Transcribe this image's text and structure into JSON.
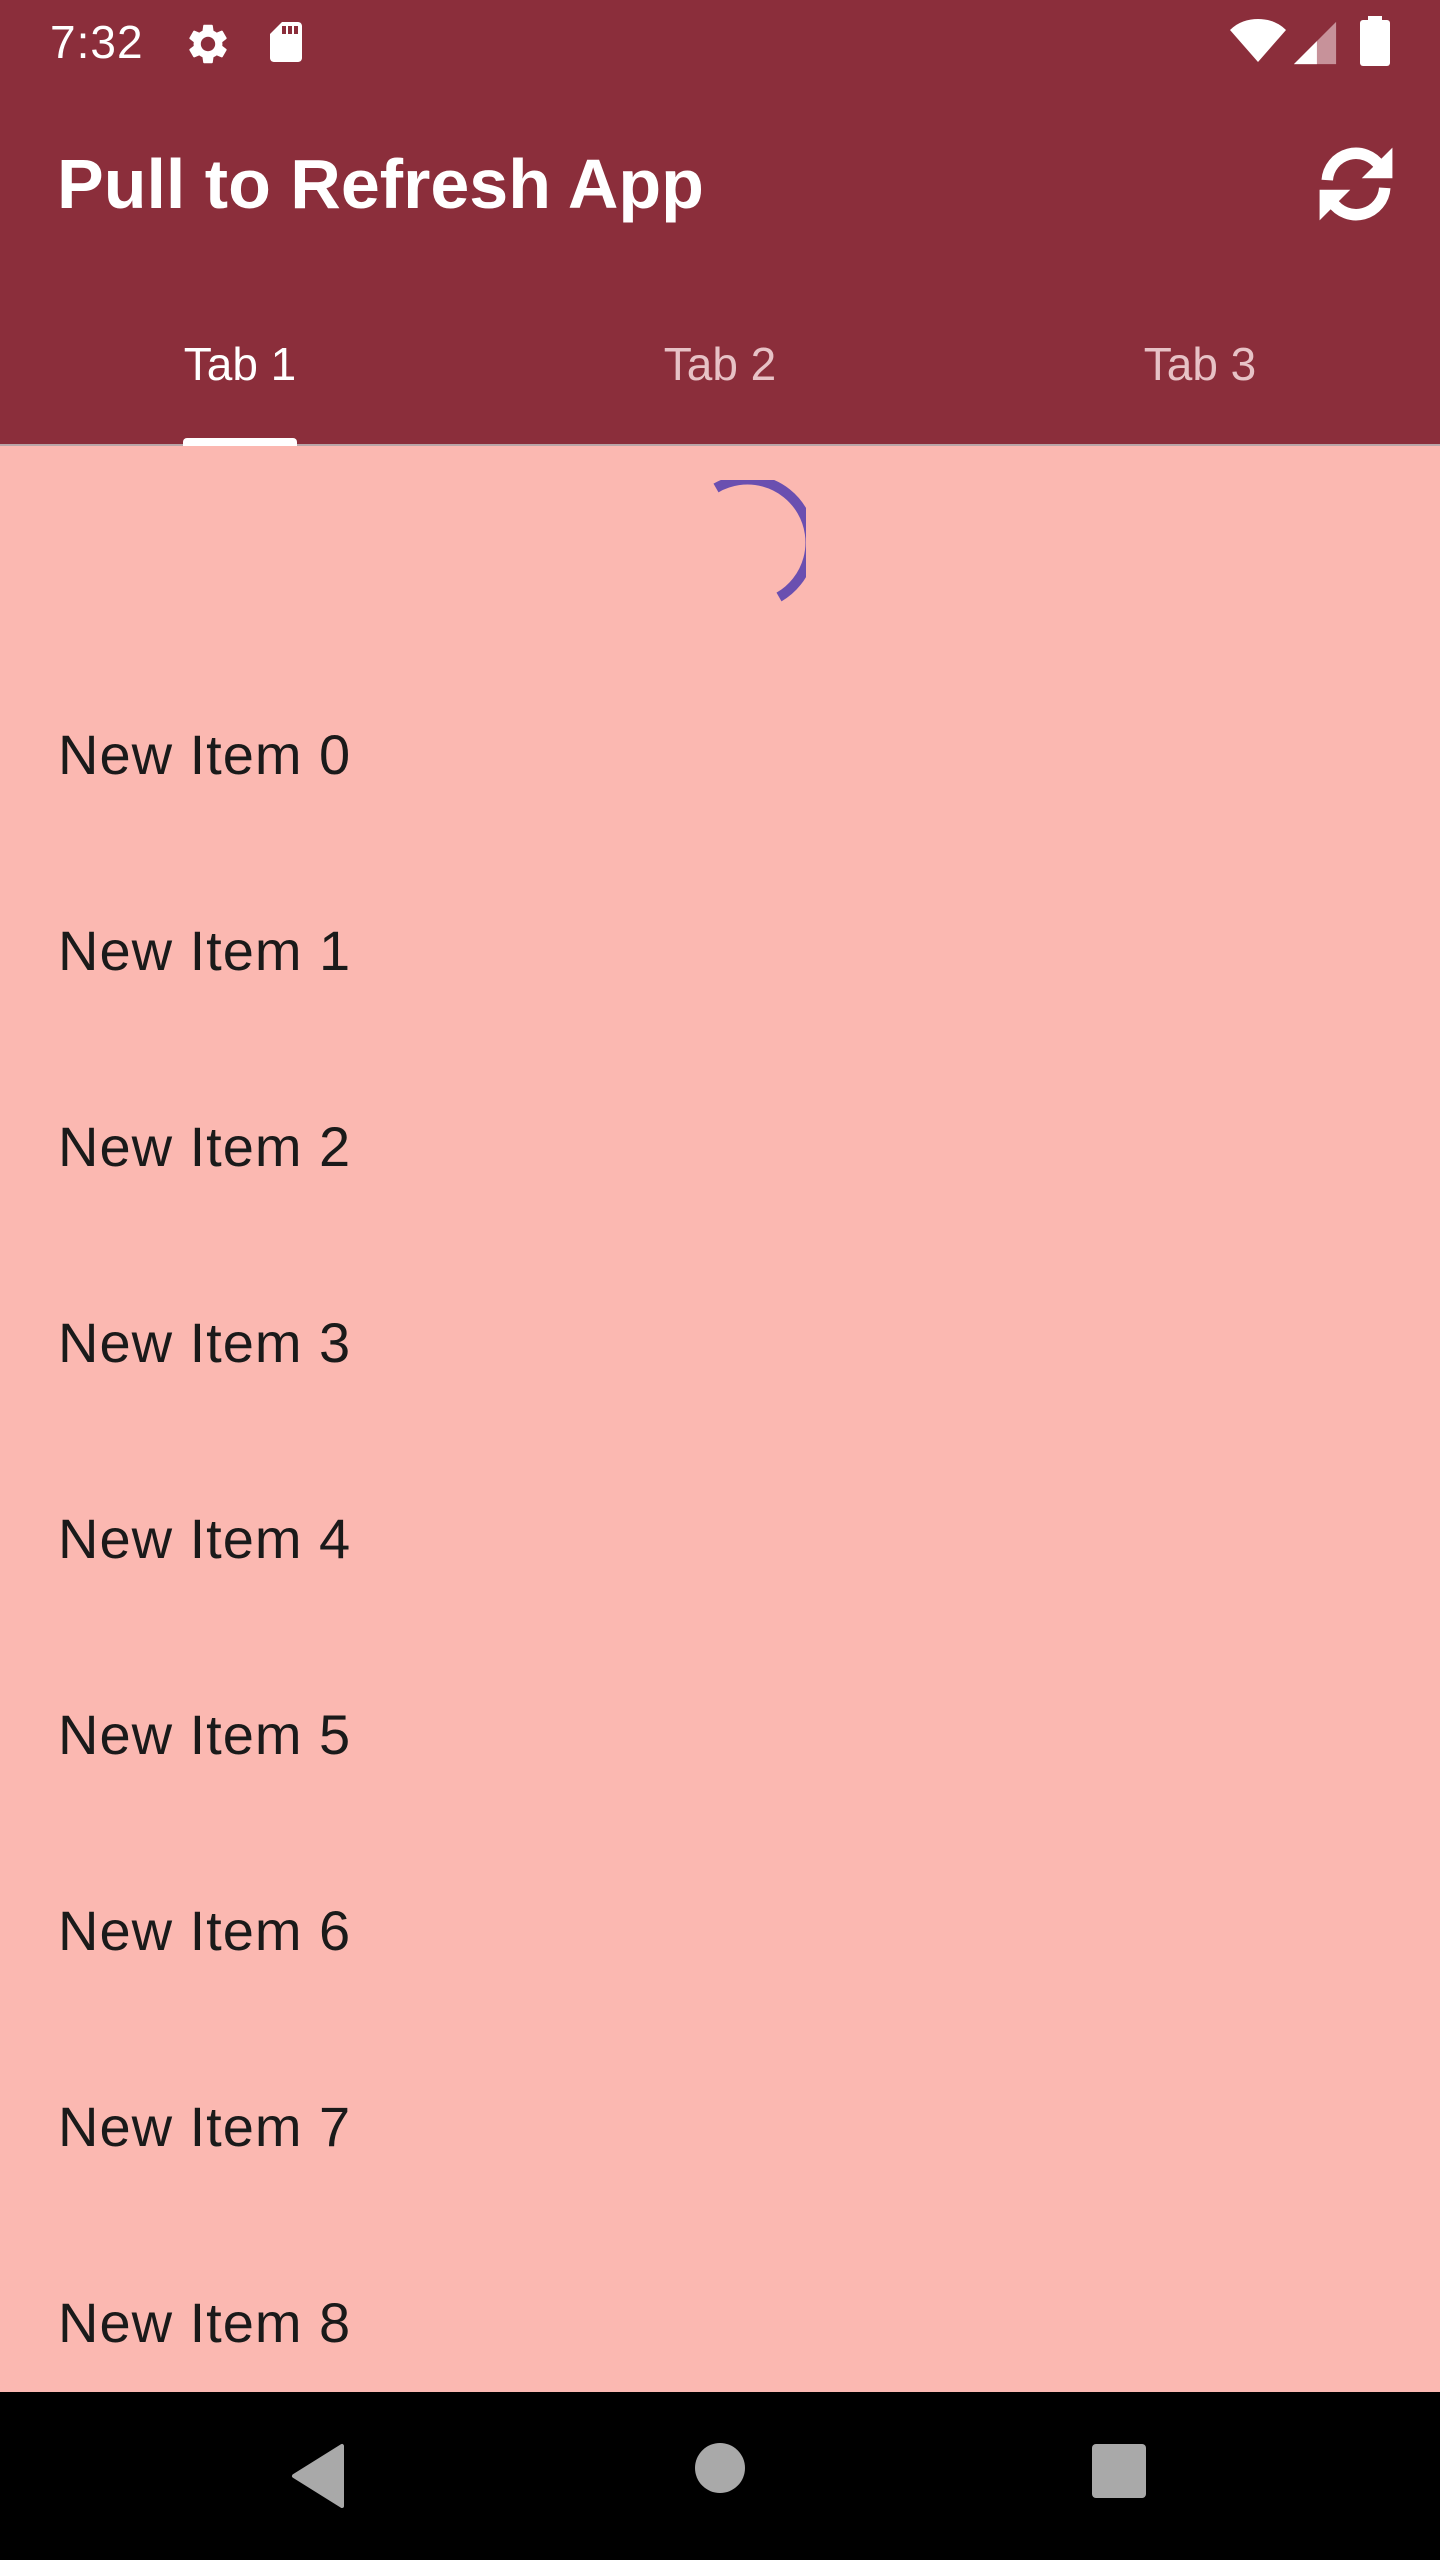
{
  "status_bar": {
    "time": "7:32",
    "icons": [
      "settings-icon",
      "sd-card-icon",
      "wifi-icon",
      "signal-icon",
      "battery-icon"
    ]
  },
  "app_bar": {
    "title": "Pull to Refresh App",
    "action_icon": "refresh-icon",
    "background": "#8b2e3b"
  },
  "tabs": [
    {
      "label": "Tab 1",
      "selected": true
    },
    {
      "label": "Tab 2",
      "selected": false
    },
    {
      "label": "Tab 3",
      "selected": false
    }
  ],
  "content": {
    "background": "#fbb8b1",
    "spinner_color": "#6a4fb0",
    "items": [
      {
        "label": "New Item 0"
      },
      {
        "label": "New Item 1"
      },
      {
        "label": "New Item 2"
      },
      {
        "label": "New Item 3"
      },
      {
        "label": "New Item 4"
      },
      {
        "label": "New Item 5"
      },
      {
        "label": "New Item 6"
      },
      {
        "label": "New Item 7"
      },
      {
        "label": "New Item 8"
      }
    ]
  },
  "nav_bar": {
    "icons": [
      "back-icon",
      "home-icon",
      "recents-icon"
    ]
  }
}
